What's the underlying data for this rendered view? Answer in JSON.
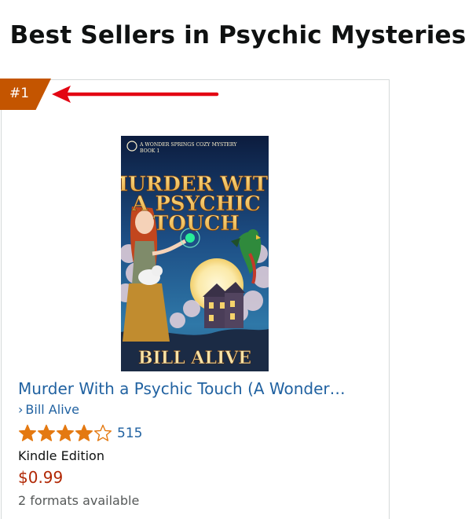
{
  "page": {
    "title": "Best Sellers in Psychic Mysteries"
  },
  "product": {
    "rank": "#1",
    "title": "Murder With a Psychic Touch (A Wonder…",
    "author": "Bill Alive",
    "author_prefix": "›",
    "rating": {
      "stars": 4,
      "max_stars": 5,
      "review_count": "515"
    },
    "format": "Kindle Edition",
    "price": "$0.99",
    "formats_available": "2 formats available",
    "cover": {
      "series_line1": "A WONDER SPRINGS COZY MYSTERY",
      "series_line2": "BOOK 1",
      "title_line1": "MURDER WITH",
      "title_line2": "A PSYCHIC",
      "title_line3": "TOUCH",
      "author": "BILL ALIVE"
    }
  },
  "colors": {
    "badge": "#c45500",
    "link": "#2162a1",
    "price": "#b12704",
    "star": "#e47911",
    "annotation_arrow": "#e30613"
  },
  "icons": {
    "annotation": "red-arrow-icon",
    "star": "star-icon"
  }
}
